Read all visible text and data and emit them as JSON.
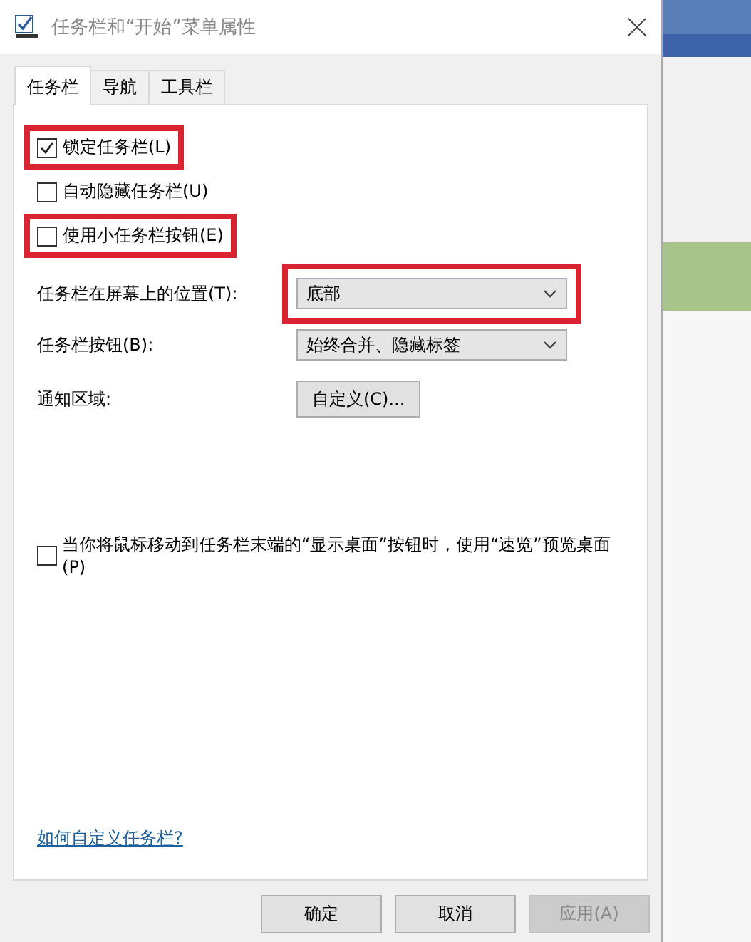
{
  "window": {
    "title": "任务栏和“开始”菜单属性"
  },
  "tabs": [
    {
      "label": "任务栏",
      "selected": true
    },
    {
      "label": "导航",
      "selected": false
    },
    {
      "label": "工具栏",
      "selected": false
    }
  ],
  "checkboxes": [
    {
      "label": "锁定任务栏(L)",
      "checked": true,
      "highlighted": true
    },
    {
      "label": "自动隐藏任务栏(U)",
      "checked": false,
      "highlighted": false
    },
    {
      "label": "使用小任务栏按钮(E)",
      "checked": false,
      "highlighted": true
    }
  ],
  "settings": [
    {
      "kind": "dropdown",
      "label": "任务栏在屏幕上的位置(T):",
      "value": "底部",
      "highlighted": true
    },
    {
      "kind": "dropdown",
      "label": "任务栏按钮(B):",
      "value": "始终合并、隐藏标签",
      "highlighted": false
    },
    {
      "kind": "button",
      "label": "通知区域:",
      "value": "自定义(C)...",
      "highlighted": false
    }
  ],
  "peek_option": {
    "label": "当你将鼠标移动到任务栏末端的“显示桌面”按钮时，使用“速览”预览桌面(P)",
    "checked": false
  },
  "help_link": "如何自定义任务栏?",
  "buttons": [
    {
      "label": "确定",
      "disabled": false
    },
    {
      "label": "取消",
      "disabled": false
    },
    {
      "label": "应用(A)",
      "disabled": true
    }
  ]
}
